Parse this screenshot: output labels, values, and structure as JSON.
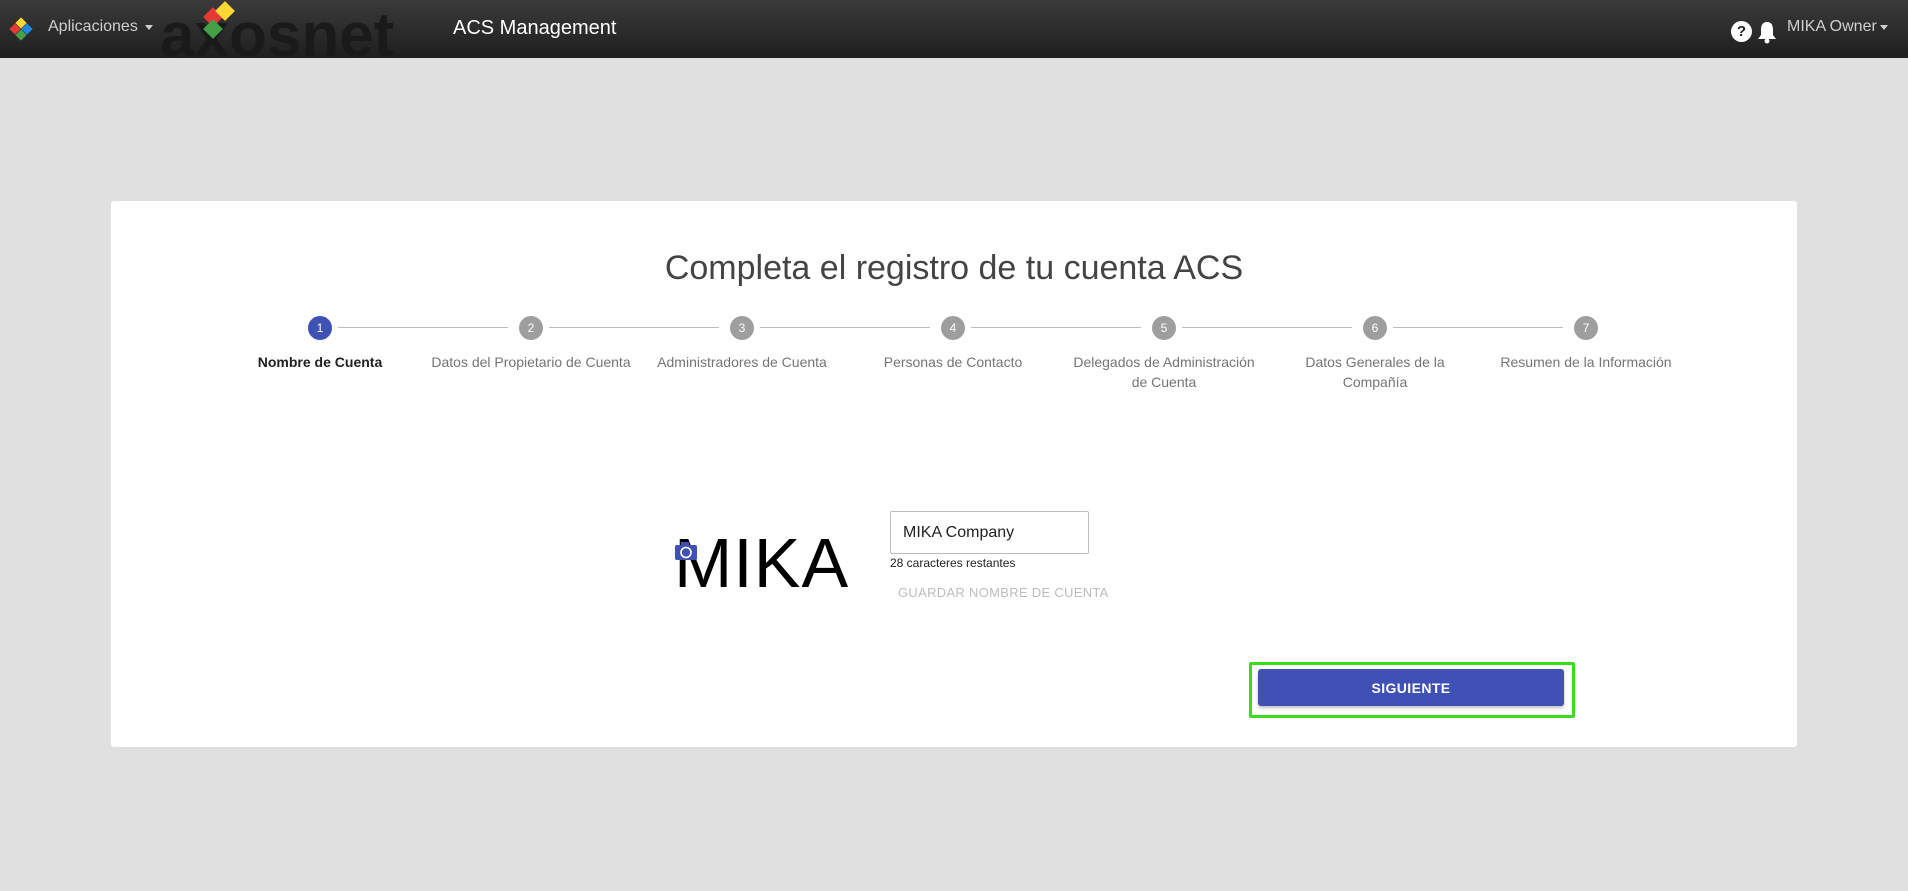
{
  "topbar": {
    "apps_menu_label": "Aplicaciones",
    "brand_name": "axosnet",
    "app_title": "ACS Management",
    "help_symbol": "?",
    "user_menu_label": "MIKA Owner"
  },
  "card": {
    "title": "Completa el registro de tu cuenta ACS",
    "steps": [
      {
        "number": "1",
        "label": "Nombre de Cuenta",
        "active": true
      },
      {
        "number": "2",
        "label": "Datos del Propietario de Cuenta",
        "active": false
      },
      {
        "number": "3",
        "label": "Administradores de Cuenta",
        "active": false
      },
      {
        "number": "4",
        "label": "Personas de Contacto",
        "active": false
      },
      {
        "number": "5",
        "label": "Delegados de Administración de Cuenta",
        "active": false
      },
      {
        "number": "6",
        "label": "Datos Generales de la Compañía",
        "active": false
      },
      {
        "number": "7",
        "label": "Resumen de la Información",
        "active": false
      }
    ],
    "logo_text": "MIKA",
    "account_name_value": "MIKA Company",
    "chars_remaining": "28 caracteres restantes",
    "save_name_label": "GUARDAR NOMBRE DE CUENTA",
    "next_label": "SIGUIENTE"
  },
  "colors": {
    "primary": "#3f51b5",
    "step_inactive": "#9e9e9e",
    "highlight": "#3ddc1a",
    "topbar": "#2b2b2b",
    "background": "#e0e0e0"
  },
  "icons": [
    "app-grid-icon",
    "help-icon",
    "bell-icon",
    "camera-icon"
  ]
}
